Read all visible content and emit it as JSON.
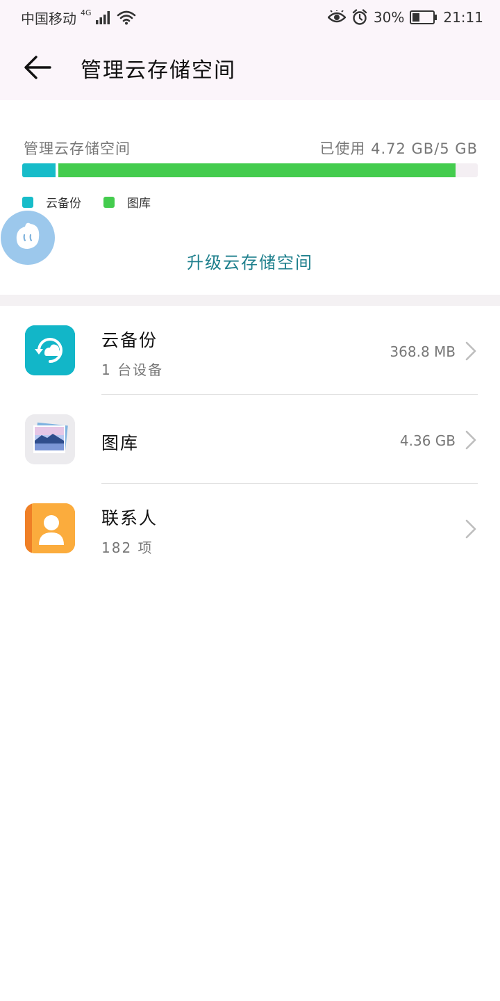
{
  "status_bar": {
    "carrier": "中国移动",
    "network": "4G",
    "battery": "30%",
    "time": "21:11"
  },
  "header": {
    "title": "管理云存储空间"
  },
  "usage": {
    "label": "管理云存储空间",
    "value": "已使用 4.72 GB/5 GB",
    "segments": [
      {
        "name": "云备份",
        "fraction": 0.0737,
        "color": "#17bcc9"
      },
      {
        "name": "图库",
        "fraction": 0.872,
        "color": "#44cc4e"
      }
    ],
    "remaining_color": "#f4eff3",
    "legend": [
      {
        "label": "云备份",
        "color": "#17bcc9"
      },
      {
        "label": "图库",
        "color": "#44cc4e"
      }
    ],
    "upgrade_label": "升级云存储空间"
  },
  "items": [
    {
      "title": "云备份",
      "subtitle": "1 台设备",
      "value": "368.8 MB",
      "icon": "cloud-backup-icon"
    },
    {
      "title": "图库",
      "subtitle": "",
      "value": "4.36 GB",
      "icon": "gallery-icon"
    },
    {
      "title": "联系人",
      "subtitle": "182 项",
      "value": "",
      "icon": "contacts-icon"
    }
  ]
}
